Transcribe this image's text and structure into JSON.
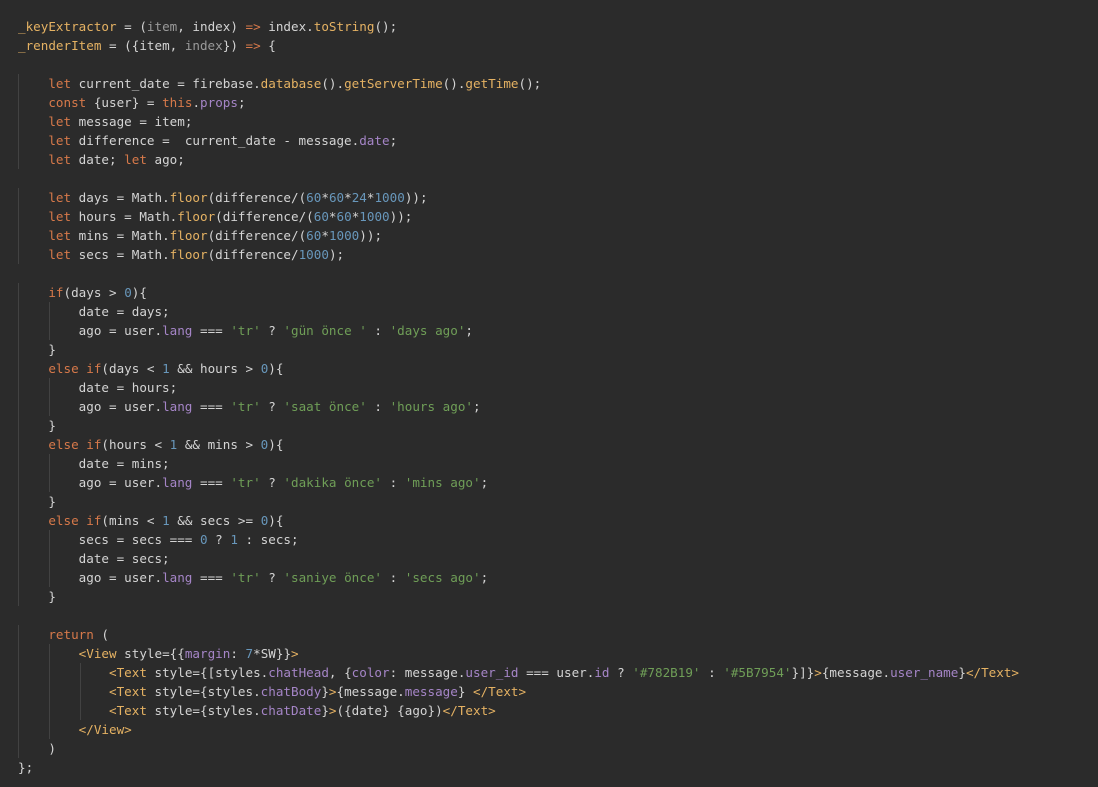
{
  "colors": {
    "background": "#2b2b2b",
    "plain": "#d4d4d4",
    "keyword": "#d7794a",
    "function": "#e5b263",
    "property": "#a585c7",
    "string": "#6f9e57",
    "number": "#6897bb",
    "indent_guide": "#424242"
  },
  "code_lines": [
    [
      [
        "fn",
        "_keyExtractor"
      ],
      [
        "plain",
        " = ("
      ],
      [
        "param",
        "item"
      ],
      [
        "plain",
        ", index) "
      ],
      [
        "kw",
        "=>"
      ],
      [
        "plain",
        " index."
      ],
      [
        "fn",
        "toString"
      ],
      [
        "plain",
        "();"
      ]
    ],
    [
      [
        "fn",
        "_renderItem"
      ],
      [
        "plain",
        " = ({item, "
      ],
      [
        "param",
        "index"
      ],
      [
        "plain",
        "}) "
      ],
      [
        "kw",
        "=>"
      ],
      [
        "plain",
        " {"
      ]
    ],
    [],
    [
      [
        "plain",
        "    "
      ],
      [
        "kw",
        "let"
      ],
      [
        "plain",
        " current_date = firebase."
      ],
      [
        "fn",
        "database"
      ],
      [
        "plain",
        "()."
      ],
      [
        "fn",
        "getServerTime"
      ],
      [
        "plain",
        "()."
      ],
      [
        "fn",
        "getTime"
      ],
      [
        "plain",
        "();"
      ]
    ],
    [
      [
        "plain",
        "    "
      ],
      [
        "kw",
        "const"
      ],
      [
        "plain",
        " {user} = "
      ],
      [
        "kw",
        "this"
      ],
      [
        "plain",
        "."
      ],
      [
        "prop",
        "props"
      ],
      [
        "plain",
        ";"
      ]
    ],
    [
      [
        "plain",
        "    "
      ],
      [
        "kw",
        "let"
      ],
      [
        "plain",
        " message = item;"
      ]
    ],
    [
      [
        "plain",
        "    "
      ],
      [
        "kw",
        "let"
      ],
      [
        "plain",
        " difference =  current_date - message."
      ],
      [
        "prop",
        "date"
      ],
      [
        "plain",
        ";"
      ]
    ],
    [
      [
        "plain",
        "    "
      ],
      [
        "kw",
        "let"
      ],
      [
        "plain",
        " date; "
      ],
      [
        "kw",
        "let"
      ],
      [
        "plain",
        " ago;"
      ]
    ],
    [],
    [
      [
        "plain",
        "    "
      ],
      [
        "kw",
        "let"
      ],
      [
        "plain",
        " days = Math."
      ],
      [
        "fn",
        "floor"
      ],
      [
        "plain",
        "(difference/("
      ],
      [
        "num",
        "60"
      ],
      [
        "plain",
        "*"
      ],
      [
        "num",
        "60"
      ],
      [
        "plain",
        "*"
      ],
      [
        "num",
        "24"
      ],
      [
        "plain",
        "*"
      ],
      [
        "num",
        "1000"
      ],
      [
        "plain",
        "));"
      ]
    ],
    [
      [
        "plain",
        "    "
      ],
      [
        "kw",
        "let"
      ],
      [
        "plain",
        " hours = Math."
      ],
      [
        "fn",
        "floor"
      ],
      [
        "plain",
        "(difference/("
      ],
      [
        "num",
        "60"
      ],
      [
        "plain",
        "*"
      ],
      [
        "num",
        "60"
      ],
      [
        "plain",
        "*"
      ],
      [
        "num",
        "1000"
      ],
      [
        "plain",
        "));"
      ]
    ],
    [
      [
        "plain",
        "    "
      ],
      [
        "kw",
        "let"
      ],
      [
        "plain",
        " mins = Math."
      ],
      [
        "fn",
        "floor"
      ],
      [
        "plain",
        "(difference/("
      ],
      [
        "num",
        "60"
      ],
      [
        "plain",
        "*"
      ],
      [
        "num",
        "1000"
      ],
      [
        "plain",
        "));"
      ]
    ],
    [
      [
        "plain",
        "    "
      ],
      [
        "kw",
        "let"
      ],
      [
        "plain",
        " secs = Math."
      ],
      [
        "fn",
        "floor"
      ],
      [
        "plain",
        "(difference/"
      ],
      [
        "num",
        "1000"
      ],
      [
        "plain",
        ");"
      ]
    ],
    [],
    [
      [
        "plain",
        "    "
      ],
      [
        "kw",
        "if"
      ],
      [
        "plain",
        "(days > "
      ],
      [
        "num",
        "0"
      ],
      [
        "plain",
        "){"
      ]
    ],
    [
      [
        "plain",
        "        date = days;"
      ]
    ],
    [
      [
        "plain",
        "        ago = user."
      ],
      [
        "prop",
        "lang"
      ],
      [
        "plain",
        " === "
      ],
      [
        "str",
        "'tr'"
      ],
      [
        "plain",
        " ? "
      ],
      [
        "str",
        "'gün önce '"
      ],
      [
        "plain",
        " : "
      ],
      [
        "str",
        "'days ago'"
      ],
      [
        "plain",
        ";"
      ]
    ],
    [
      [
        "plain",
        "    }"
      ]
    ],
    [
      [
        "plain",
        "    "
      ],
      [
        "kw",
        "else if"
      ],
      [
        "plain",
        "(days < "
      ],
      [
        "num",
        "1"
      ],
      [
        "plain",
        " && hours > "
      ],
      [
        "num",
        "0"
      ],
      [
        "plain",
        "){"
      ]
    ],
    [
      [
        "plain",
        "        date = hours;"
      ]
    ],
    [
      [
        "plain",
        "        ago = user."
      ],
      [
        "prop",
        "lang"
      ],
      [
        "plain",
        " === "
      ],
      [
        "str",
        "'tr'"
      ],
      [
        "plain",
        " ? "
      ],
      [
        "str",
        "'saat önce'"
      ],
      [
        "plain",
        " : "
      ],
      [
        "str",
        "'hours ago'"
      ],
      [
        "plain",
        ";"
      ]
    ],
    [
      [
        "plain",
        "    }"
      ]
    ],
    [
      [
        "plain",
        "    "
      ],
      [
        "kw",
        "else if"
      ],
      [
        "plain",
        "(hours < "
      ],
      [
        "num",
        "1"
      ],
      [
        "plain",
        " && mins > "
      ],
      [
        "num",
        "0"
      ],
      [
        "plain",
        "){"
      ]
    ],
    [
      [
        "plain",
        "        date = mins;"
      ]
    ],
    [
      [
        "plain",
        "        ago = user."
      ],
      [
        "prop",
        "lang"
      ],
      [
        "plain",
        " === "
      ],
      [
        "str",
        "'tr'"
      ],
      [
        "plain",
        " ? "
      ],
      [
        "str",
        "'dakika önce'"
      ],
      [
        "plain",
        " : "
      ],
      [
        "str",
        "'mins ago'"
      ],
      [
        "plain",
        ";"
      ]
    ],
    [
      [
        "plain",
        "    }"
      ]
    ],
    [
      [
        "plain",
        "    "
      ],
      [
        "kw",
        "else if"
      ],
      [
        "plain",
        "(mins < "
      ],
      [
        "num",
        "1"
      ],
      [
        "plain",
        " && secs >= "
      ],
      [
        "num",
        "0"
      ],
      [
        "plain",
        "){"
      ]
    ],
    [
      [
        "plain",
        "        secs = secs === "
      ],
      [
        "num",
        "0"
      ],
      [
        "plain",
        " ? "
      ],
      [
        "num",
        "1"
      ],
      [
        "plain",
        " : secs;"
      ]
    ],
    [
      [
        "plain",
        "        date = secs;"
      ]
    ],
    [
      [
        "plain",
        "        ago = user."
      ],
      [
        "prop",
        "lang"
      ],
      [
        "plain",
        " === "
      ],
      [
        "str",
        "'tr'"
      ],
      [
        "plain",
        " ? "
      ],
      [
        "str",
        "'saniye önce'"
      ],
      [
        "plain",
        " : "
      ],
      [
        "str",
        "'secs ago'"
      ],
      [
        "plain",
        ";"
      ]
    ],
    [
      [
        "plain",
        "    }"
      ]
    ],
    [],
    [
      [
        "plain",
        "    "
      ],
      [
        "kw",
        "return"
      ],
      [
        "plain",
        " ("
      ]
    ],
    [
      [
        "plain",
        "        "
      ],
      [
        "tag",
        "<View"
      ],
      [
        "plain",
        " style={{"
      ],
      [
        "prop",
        "margin"
      ],
      [
        "plain",
        ": "
      ],
      [
        "num",
        "7"
      ],
      [
        "plain",
        "*SW}}"
      ],
      [
        "tag",
        ">"
      ]
    ],
    [
      [
        "plain",
        "            "
      ],
      [
        "tag",
        "<Text"
      ],
      [
        "plain",
        " style={[styles."
      ],
      [
        "prop",
        "chatHead"
      ],
      [
        "plain",
        ", {"
      ],
      [
        "prop",
        "color"
      ],
      [
        "plain",
        ": message."
      ],
      [
        "prop",
        "user_id"
      ],
      [
        "plain",
        " === user."
      ],
      [
        "prop",
        "id"
      ],
      [
        "plain",
        " ? "
      ],
      [
        "str",
        "'#782B19'"
      ],
      [
        "plain",
        " : "
      ],
      [
        "str",
        "'#5B7954'"
      ],
      [
        "plain",
        "}]}"
      ],
      [
        "tag",
        ">"
      ],
      [
        "plain",
        "{message."
      ],
      [
        "prop",
        "user_name"
      ],
      [
        "plain",
        "}"
      ],
      [
        "tag",
        "</Text>"
      ]
    ],
    [
      [
        "plain",
        "            "
      ],
      [
        "tag",
        "<Text"
      ],
      [
        "plain",
        " style={styles."
      ],
      [
        "prop",
        "chatBody"
      ],
      [
        "plain",
        "}"
      ],
      [
        "tag",
        ">"
      ],
      [
        "plain",
        "{message."
      ],
      [
        "prop",
        "message"
      ],
      [
        "plain",
        "} "
      ],
      [
        "tag",
        "</Text>"
      ]
    ],
    [
      [
        "plain",
        "            "
      ],
      [
        "tag",
        "<Text"
      ],
      [
        "plain",
        " style={styles."
      ],
      [
        "prop",
        "chatDate"
      ],
      [
        "plain",
        "}"
      ],
      [
        "tag",
        ">"
      ],
      [
        "plain",
        "({date} {ago})"
      ],
      [
        "tag",
        "</Text>"
      ]
    ],
    [
      [
        "plain",
        "        "
      ],
      [
        "tag",
        "</View>"
      ]
    ],
    [
      [
        "plain",
        "    )"
      ]
    ],
    [
      [
        "plain",
        "};"
      ]
    ]
  ]
}
